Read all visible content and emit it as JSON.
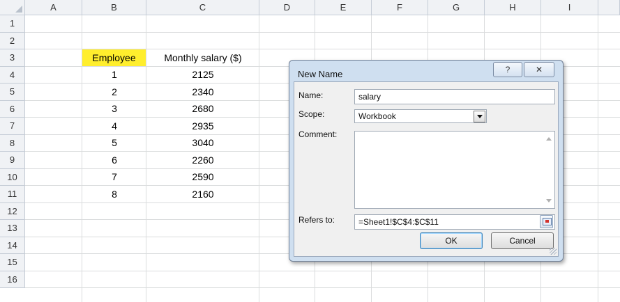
{
  "sheet": {
    "columns": [
      "A",
      "B",
      "C",
      "D",
      "E",
      "F",
      "G",
      "H",
      "I"
    ],
    "rows": [
      "1",
      "2",
      "3",
      "4",
      "5",
      "6",
      "7",
      "8",
      "9",
      "10",
      "11",
      "12",
      "13",
      "14",
      "15",
      "16"
    ],
    "table": {
      "header_employee": "Employee",
      "header_salary": "Monthly salary ($)",
      "highlight_color": "#ffee2d",
      "employees": [
        "1",
        "2",
        "3",
        "4",
        "5",
        "6",
        "7",
        "8"
      ],
      "salaries": [
        "2125",
        "2340",
        "2680",
        "2935",
        "3040",
        "2260",
        "2590",
        "2160"
      ]
    }
  },
  "dialog": {
    "title": "New Name",
    "help_glyph": "?",
    "close_glyph": "✕",
    "name_label": "Name:",
    "name_value": "salary",
    "scope_label": "Scope:",
    "scope_value": "Workbook",
    "comment_label": "Comment:",
    "comment_value": "",
    "refers_label": "Refers to:",
    "refers_value": "=Sheet1!$C$4:$C$11",
    "ok_label": "OK",
    "cancel_label": "Cancel"
  }
}
